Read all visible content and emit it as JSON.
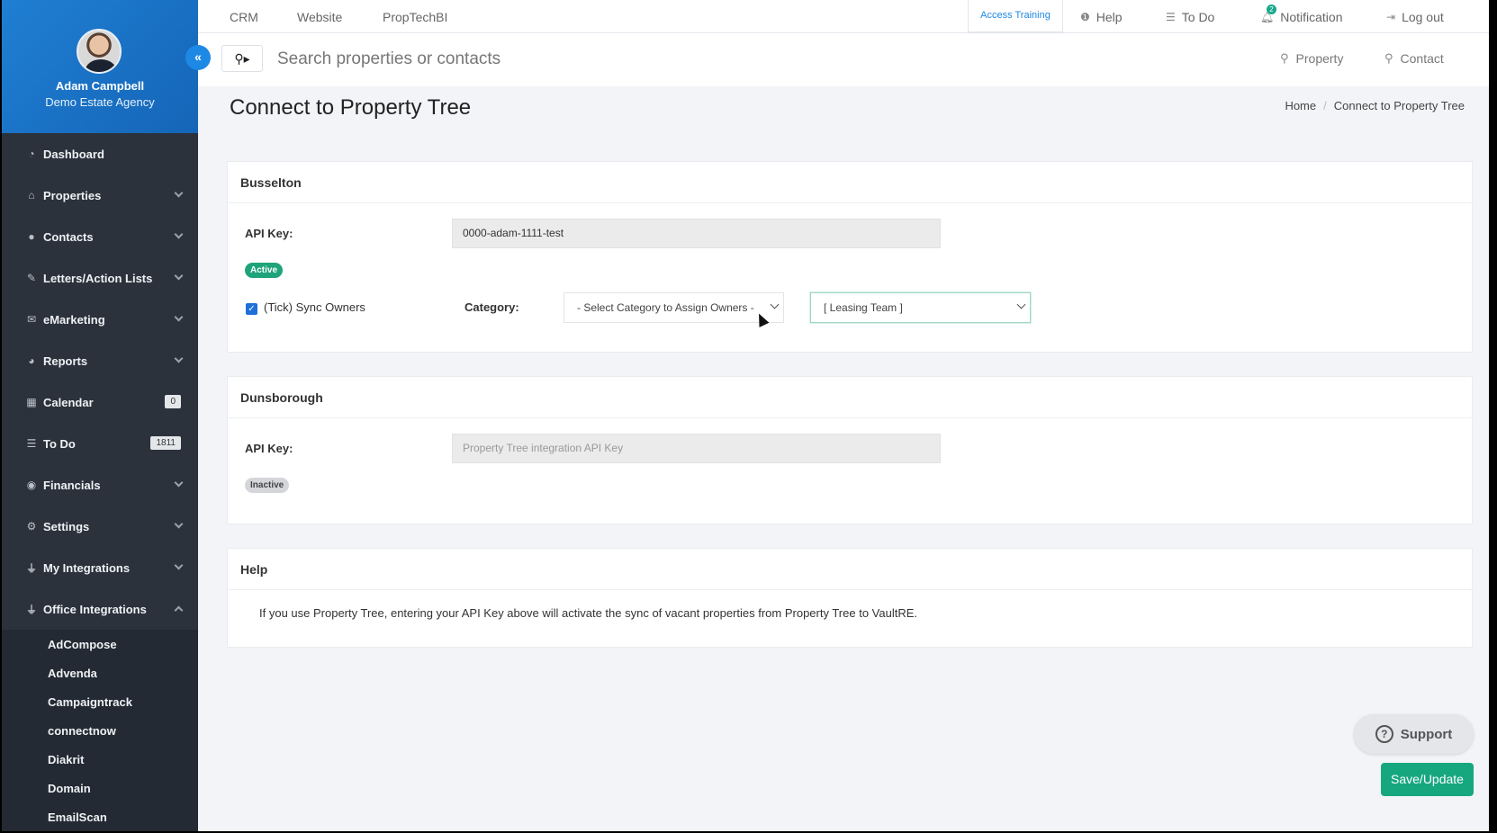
{
  "sidebar": {
    "user_name": "Adam Campbell",
    "agency": "Demo Estate Agency",
    "collapse_icon": "«",
    "items": [
      {
        "label": "Dashboard",
        "icon": "dashboard-icon",
        "glyph": "◔"
      },
      {
        "label": "Properties",
        "icon": "home-icon",
        "glyph": "⌂"
      },
      {
        "label": "Contacts",
        "icon": "user-icon",
        "glyph": "●"
      },
      {
        "label": "Letters/Action Lists",
        "icon": "edit-icon",
        "glyph": "✎"
      },
      {
        "label": "eMarketing",
        "icon": "envelope-icon",
        "glyph": "✉"
      },
      {
        "label": "Reports",
        "icon": "pie-chart-icon",
        "glyph": "◕"
      },
      {
        "label": "Calendar",
        "icon": "calendar-icon",
        "glyph": "▦",
        "badge": "0"
      },
      {
        "label": "To Do",
        "icon": "list-icon",
        "glyph": "☰",
        "badge": "1811"
      },
      {
        "label": "Financials",
        "icon": "money-icon",
        "glyph": "◉"
      },
      {
        "label": "Settings",
        "icon": "cogs-icon",
        "glyph": "⚙"
      },
      {
        "label": "My Integrations",
        "icon": "plug-icon",
        "glyph": "⏚"
      },
      {
        "label": "Office Integrations",
        "icon": "plug-icon",
        "glyph": "⏚"
      }
    ],
    "office_integrations": [
      "AdCompose",
      "Advenda",
      "Campaigntrack",
      "connectnow",
      "Diakrit",
      "Domain",
      "EmailScan"
    ]
  },
  "topbar": {
    "crm": "CRM",
    "website": "Website",
    "proptechbi": "PropTechBI",
    "access_training": "Access Training",
    "help": "Help",
    "todo": "To Do",
    "notification": "Notification",
    "notification_count": "2",
    "logout": "Log out"
  },
  "search": {
    "placeholder": "Search properties or contacts",
    "property": "Property",
    "contact": "Contact"
  },
  "page": {
    "title": "Connect to Property Tree",
    "breadcrumb_home": "Home",
    "breadcrumb_current": "Connect to Property Tree"
  },
  "busselton": {
    "title": "Busselton",
    "api_label": "API Key:",
    "api_value": "0000-adam-1111-test",
    "status": "Active",
    "sync_label": "(Tick) Sync Owners",
    "category_label": "Category:",
    "category_select": "- Select Category to Assign Owners -",
    "team_select": "[ Leasing Team ]"
  },
  "dunsborough": {
    "title": "Dunsborough",
    "api_label": "API Key:",
    "api_placeholder": "Property Tree integration API Key",
    "status": "Inactive"
  },
  "help": {
    "title": "Help",
    "text": "If you use Property Tree, entering your API Key above will activate the sync of vacant properties from Property Tree to VaultRE."
  },
  "buttons": {
    "support": "Support",
    "save": "Save/Update"
  },
  "colors": {
    "accent": "#1e88e5",
    "success": "#16a77f",
    "sidebar": "#2b323c"
  }
}
